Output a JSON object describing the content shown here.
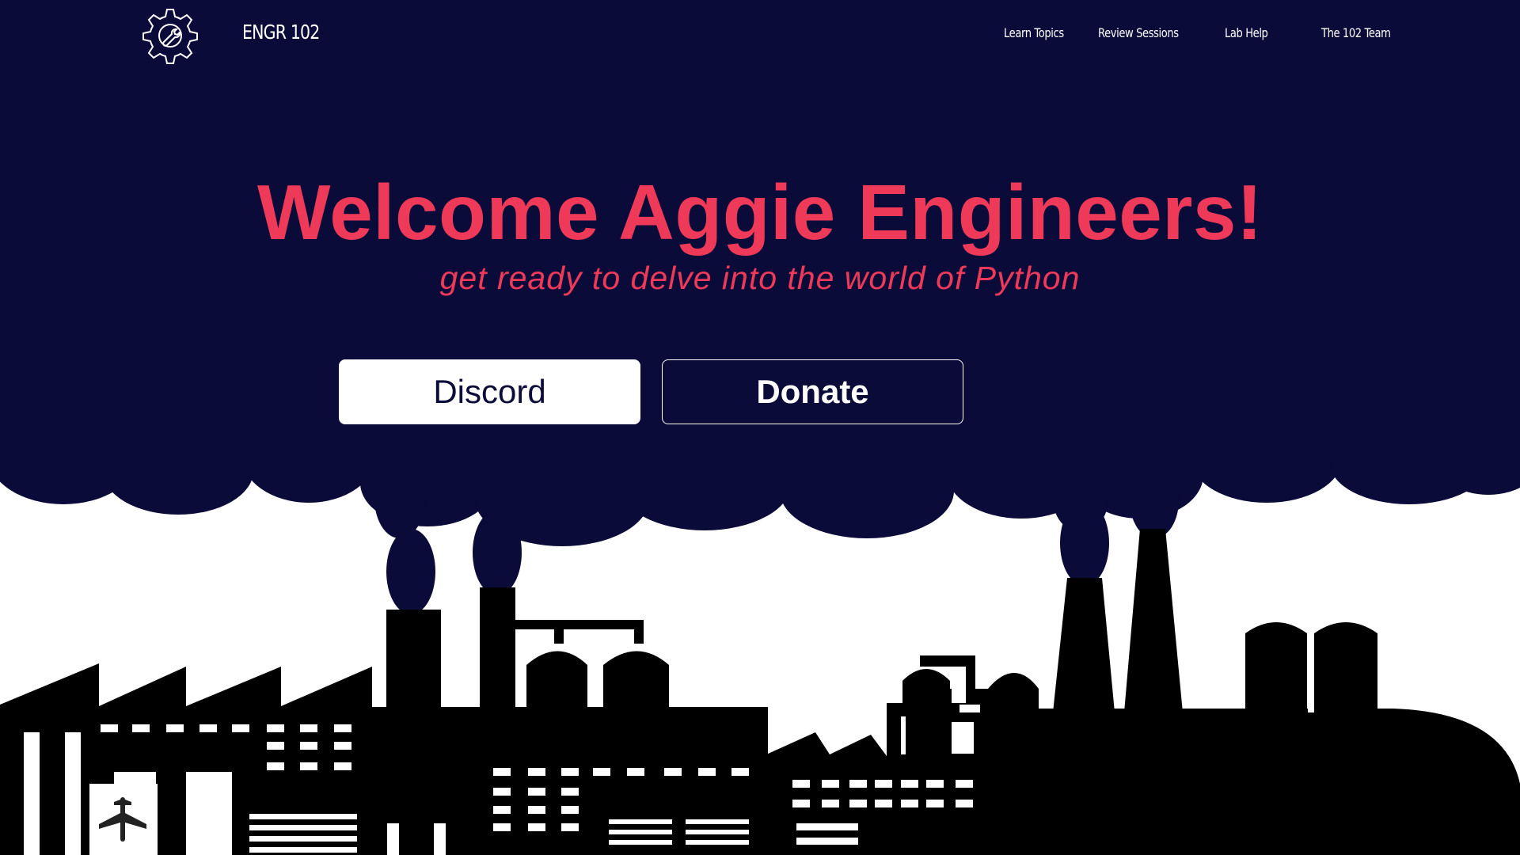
{
  "nav": {
    "brand": "ENGR 102",
    "logo_icon": "gear-wrench-icon",
    "links": [
      {
        "label": "Learn Topics"
      },
      {
        "label": "Review Sessions"
      },
      {
        "label": "Lab Help"
      },
      {
        "label": "The 102 Team"
      }
    ]
  },
  "hero": {
    "title": "Welcome Aggie Engineers!",
    "subtitle": "get ready to delve into the world of Python",
    "buttons": {
      "discord_label": "Discord",
      "donate_label": "Donate"
    }
  },
  "colors": {
    "navy": "#0b0b3a",
    "accent": "#ee3a58",
    "silhouette": "#000000",
    "white": "#ffffff"
  },
  "illustration": {
    "icon": "airplane-icon"
  }
}
